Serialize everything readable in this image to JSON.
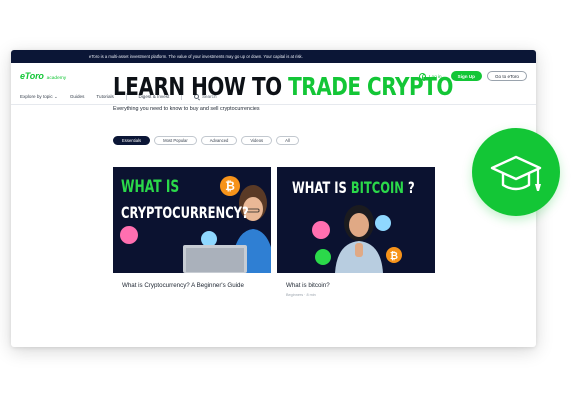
{
  "disclaimer": "eToro is a multi-asset investment platform. The value of your investments may go up or down. Your capital is at risk.",
  "header": {
    "logo": "eToro",
    "logo_sub": "academy",
    "login": "Log in",
    "signup": "Sign Up",
    "goto": "Go to eToro"
  },
  "nav": {
    "explore": "Explore by topic",
    "guides": "Guides",
    "tutorials": "Tutorials",
    "digest": "Digest & Invest",
    "search": "Search"
  },
  "hero": {
    "title_start": "LEARN HOW TO ",
    "title_highlight": "TRADE CRYPTO",
    "subtitle": "Everything you need to know to buy and sell cryptocurrencies"
  },
  "filters": [
    "Essentials",
    "Most Popular",
    "Advanced",
    "Videos",
    "All"
  ],
  "cards": [
    {
      "thumb_line1": "WHAT IS",
      "thumb_line2": "CRYPTOCURRENCY?",
      "title": "What is Cryptocurrency? A Beginner's Guide"
    },
    {
      "thumb_prefix": "WHAT IS ",
      "thumb_highlight": "BITCOIN",
      "thumb_suffix": " ?",
      "title": "What is bitcoin?",
      "meta": "Beginners · 8 min"
    }
  ],
  "colors": {
    "brand_green": "#13c636",
    "navy": "#0b1636",
    "thumb_bg": "#0b1230",
    "bitcoin_orange": "#f7931a"
  },
  "badge_icon": "graduation-cap-icon"
}
